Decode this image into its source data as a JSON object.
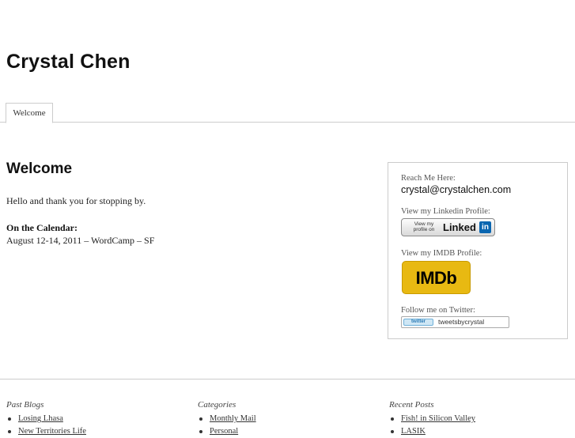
{
  "site": {
    "title": "Crystal Chen"
  },
  "nav": {
    "tabs": [
      {
        "label": "Welcome"
      }
    ]
  },
  "main": {
    "heading": "Welcome",
    "intro": "Hello and thank you for stopping by.",
    "calendar_label": "On the Calendar:",
    "calendar_item": "August 12-14, 2011 – WordCamp – SF"
  },
  "sidebar": {
    "reach_label": "Reach Me Here:",
    "email": "crystal@crystalchen.com",
    "linkedin_label": "View my Linkedin Profile:",
    "linkedin_button": {
      "small_text": "View my profile on",
      "word": "Linked",
      "badge": "in"
    },
    "imdb_label": "View my IMDB Profile:",
    "imdb_logo_text": "IMDb",
    "twitter_label": "Follow me on Twitter:",
    "twitter_button": {
      "logo_text": "twitter",
      "handle": "tweetsbycrystal"
    }
  },
  "footer": {
    "columns": [
      {
        "title": "Past Blogs",
        "links": [
          "Losing Lhasa",
          "New Territories Life"
        ]
      },
      {
        "title": "Categories",
        "links": [
          "Monthly Mail",
          "Personal"
        ]
      },
      {
        "title": "Recent Posts",
        "links": [
          "Fish! in Silicon Valley",
          "LASIK"
        ]
      }
    ]
  },
  "colors": {
    "imdb_yellow": "#e8b912",
    "linkedin_blue": "#0a66b0",
    "border_gray": "#cccccc"
  }
}
